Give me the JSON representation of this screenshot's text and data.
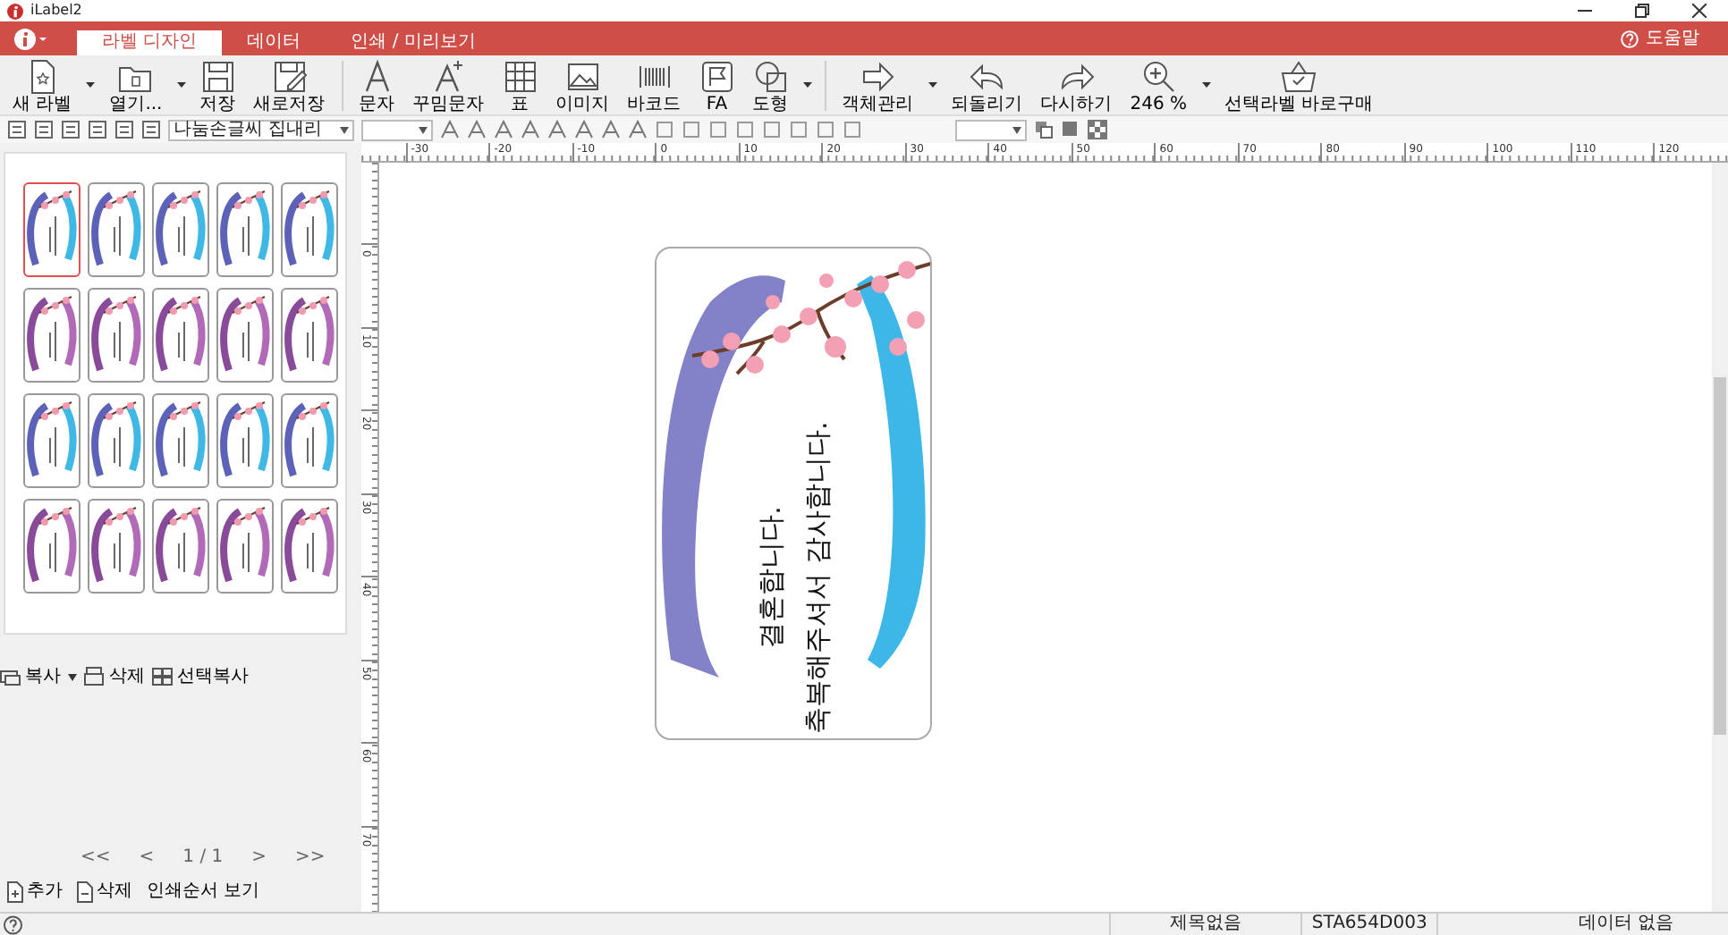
{
  "app": {
    "title": "iLabel2"
  },
  "menu_tabs": [
    {
      "label": "라벨 디자인",
      "selected": true
    },
    {
      "label": "데이터",
      "selected": false
    },
    {
      "label": "인쇄 / 미리보기",
      "selected": false
    }
  ],
  "help": "도움말",
  "toolbar": [
    {
      "label": "새 라벨",
      "dropdown": true
    },
    {
      "label": "열기...",
      "dropdown": true
    },
    {
      "label": "저장",
      "dropdown": false
    },
    {
      "label": "새로저장",
      "dropdown": false
    },
    {
      "label": "문자",
      "dropdown": false
    },
    {
      "label": "꾸밈문자",
      "dropdown": false
    },
    {
      "label": "표",
      "dropdown": false
    },
    {
      "label": "이미지",
      "dropdown": false
    },
    {
      "label": "바코드",
      "dropdown": false
    },
    {
      "label": "FA",
      "dropdown": false
    },
    {
      "label": "도형",
      "dropdown": true
    },
    {
      "label": "객체관리",
      "dropdown": true
    },
    {
      "label": "되돌리기",
      "dropdown": false
    },
    {
      "label": "다시하기",
      "dropdown": false
    },
    {
      "label": "246 %",
      "dropdown": true
    },
    {
      "label": "선택라벨 바로구매",
      "dropdown": false
    }
  ],
  "format_toolbar": {
    "font": "나눔손글씨 집내리"
  },
  "thumbnails": [
    {
      "kind": "blue",
      "selected": true
    },
    {
      "kind": "blue",
      "selected": false
    },
    {
      "kind": "blue",
      "selected": false
    },
    {
      "kind": "blue",
      "selected": false
    },
    {
      "kind": "blue",
      "selected": false
    },
    {
      "kind": "purple",
      "selected": false
    },
    {
      "kind": "purple",
      "selected": false
    },
    {
      "kind": "purple",
      "selected": false
    },
    {
      "kind": "purple",
      "selected": false
    },
    {
      "kind": "purple",
      "selected": false
    },
    {
      "kind": "blue",
      "selected": false
    },
    {
      "kind": "blue",
      "selected": false
    },
    {
      "kind": "blue",
      "selected": false
    },
    {
      "kind": "blue",
      "selected": false
    },
    {
      "kind": "blue",
      "selected": false
    },
    {
      "kind": "purple",
      "selected": false
    },
    {
      "kind": "purple",
      "selected": false
    },
    {
      "kind": "purple",
      "selected": false
    },
    {
      "kind": "purple",
      "selected": false
    },
    {
      "kind": "purple",
      "selected": false
    }
  ],
  "thumbnail_actions": [
    "복사",
    "삭제",
    "선택복사"
  ],
  "pager": {
    "first": "<<",
    "prev": "<",
    "page": "1 / 1",
    "next": ">",
    "last": ">>"
  },
  "page_actions": [
    {
      "label": "추가",
      "kind": "icon"
    },
    {
      "label": "삭제",
      "kind": "icon"
    },
    {
      "label": "인쇄순서 보기",
      "kind": "plain"
    }
  ],
  "ruler": {
    "horizontal": [
      "-30",
      "-20",
      "-10",
      "0",
      "10",
      "20",
      "30",
      "40",
      "50",
      "60",
      "70",
      "80",
      "90",
      "100",
      "110",
      "120"
    ],
    "vertical": [
      "0",
      "10",
      "20",
      "30",
      "40",
      "50",
      "60",
      "70"
    ]
  },
  "label": {
    "lines": [
      "결혼합니다.",
      "축복해주셔서 감사합니다."
    ]
  },
  "status_bar": [
    "제목없음",
    "STA654D003",
    "데이터 없음"
  ]
}
